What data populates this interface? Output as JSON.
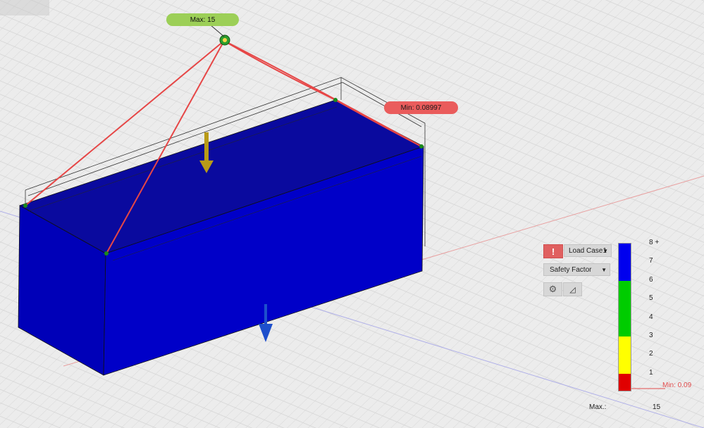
{
  "viewport": {
    "max_tag": "Max: 15",
    "min_tag": "Min: 0.08997"
  },
  "panel": {
    "warning_icon": "!",
    "load_case": "Load Case1",
    "result_type": "Safety Factor",
    "settings_icon": "gear-icon",
    "probe_icon": "probe-icon"
  },
  "legend": {
    "ticks": [
      "8 +",
      "7",
      "6",
      "5",
      "4",
      "3",
      "2",
      "1"
    ],
    "min_label": "Min: 0.09",
    "max_label": "Max.:",
    "max_value": "15",
    "colors": {
      "blue": "#0000ee",
      "green": "#00cc00",
      "yellow": "#ffff00",
      "red": "#e00000"
    }
  }
}
